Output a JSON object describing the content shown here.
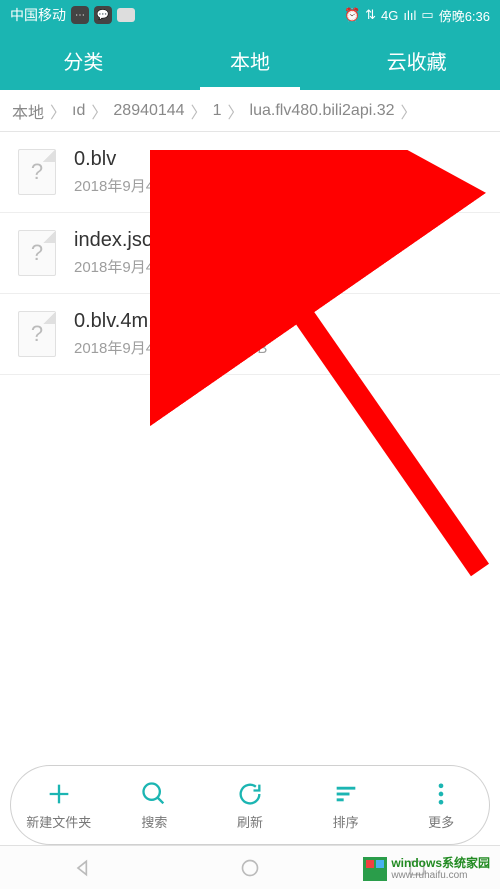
{
  "status": {
    "carrier": "中国移动",
    "alarm": "⏰",
    "wifi": "⇅",
    "network": "4G",
    "signal": "ılıl",
    "battery": "▭",
    "time": "傍晚6:36"
  },
  "tabs": {
    "category": "分类",
    "local": "本地",
    "cloud": "云收藏"
  },
  "breadcrumb": {
    "items": [
      "本地",
      "ıd",
      "28940144",
      "1",
      "lua.flv480.bili2api.32"
    ]
  },
  "files": [
    {
      "name": "0.blv",
      "info": "2018年9月4日 傍晚5:18 45.80 MB"
    },
    {
      "name": "index.json",
      "info": "2018年9月4日 傍晚5:18 1.85 kB"
    },
    {
      "name": "0.blv.4m.sum",
      "info": "2018年9月4日 傍晚5:17 19 B"
    }
  ],
  "toolbar": {
    "new_folder": "新建文件夹",
    "search": "搜索",
    "refresh": "刷新",
    "sort": "排序",
    "more": "更多"
  },
  "watermark": {
    "text_top": "windows系统家园",
    "text_bottom": "www.ruhaifu.com"
  }
}
